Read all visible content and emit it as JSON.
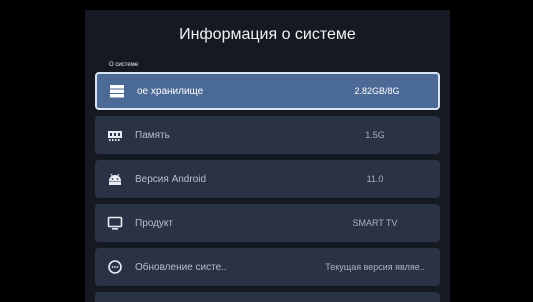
{
  "header": {
    "title": "Информация о системе",
    "breadcrumb": "О системе"
  },
  "items": [
    {
      "label": "ое хранилище",
      "value": "2.82GB/8G",
      "icon": "storage-icon"
    },
    {
      "label": "Память",
      "value": "1.5G",
      "icon": "memory-icon"
    },
    {
      "label": "Версия Android",
      "value": "11.0",
      "icon": "android-icon"
    },
    {
      "label": "Продукт",
      "value": "SMART TV",
      "icon": "monitor-icon"
    },
    {
      "label": "Обновление систе..",
      "value": "Текущая версия являе..",
      "icon": "update-icon"
    }
  ],
  "colors": {
    "background": "#000000",
    "panel": "#151a22",
    "item": "#2a3345",
    "selected_item": "#4b6a95",
    "selected_border": "#d8e3f3"
  }
}
